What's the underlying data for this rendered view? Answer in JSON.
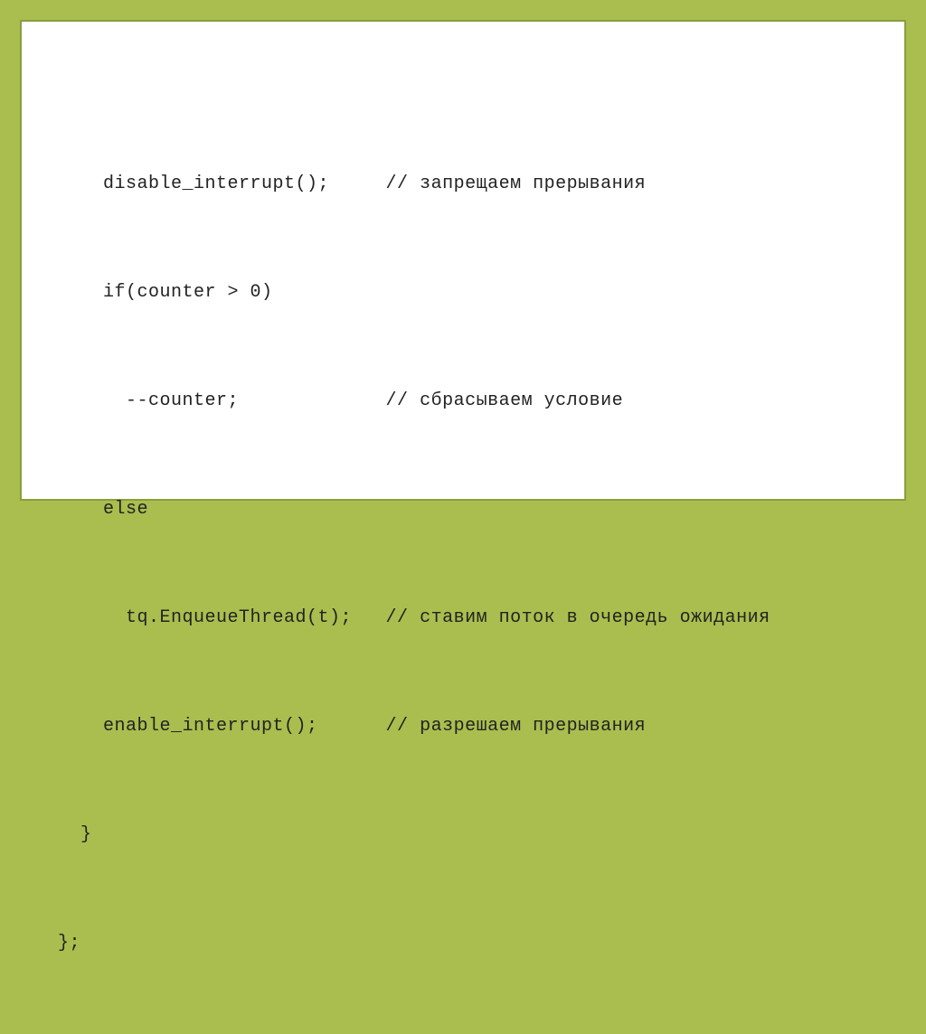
{
  "code": {
    "lines": [
      "    disable_interrupt();     // запрещаем прерывания",
      "    if(counter > 0)",
      "      --counter;             // сбрасываем условие",
      "    else",
      "      tq.EnqueueThread(t);   // ставим поток в очередь ожидания",
      "    enable_interrupt();      // разрешаем прерывания",
      "  }",
      "};"
    ]
  }
}
